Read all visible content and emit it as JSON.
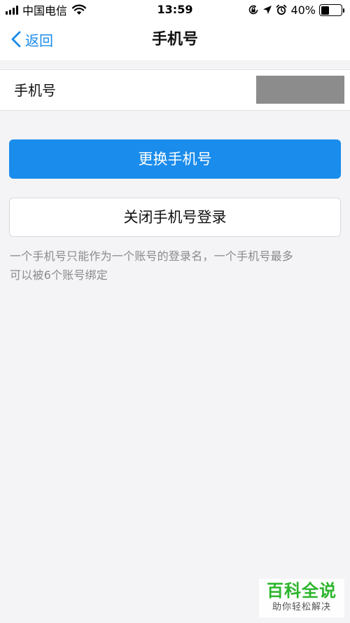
{
  "status_bar": {
    "carrier": "中国电信",
    "time": "13:59",
    "battery_percent": "40%",
    "battery_level": 0.4,
    "icons": [
      "signal-icon",
      "wifi-icon",
      "orientation-lock-icon",
      "location-icon",
      "alarm-icon",
      "battery-icon"
    ]
  },
  "nav": {
    "back_label": "返回",
    "title": "手机号"
  },
  "phone_row": {
    "label": "手机号",
    "value_hidden_color": "#8c8c8c"
  },
  "actions": {
    "change_phone_label": "更换手机号",
    "close_phone_login_label": "关闭手机号登录"
  },
  "hint": {
    "line1": "一个手机号只能作为一个账号的登录名，一个手机号最多",
    "line2": "可以被6个账号绑定"
  },
  "watermark": {
    "title": "百科全说",
    "subtitle": "助你轻松解决"
  },
  "colors": {
    "accent": "#1a8cec",
    "background": "#f4f4f6",
    "watermark_green": "#2cb52c"
  }
}
